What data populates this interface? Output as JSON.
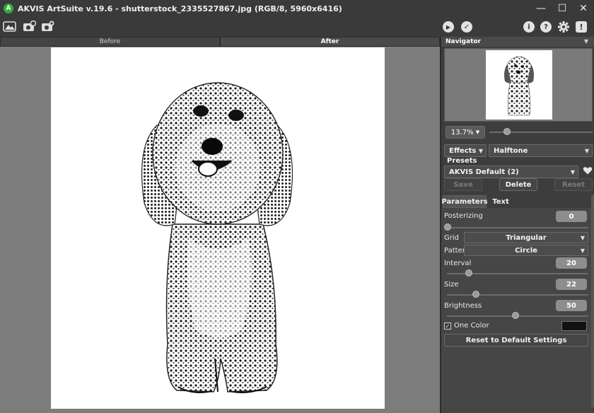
{
  "window": {
    "title": "AKVIS ArtSuite v.19.6 - shutterstock_2335527867.jpg (RGB/8, 5960x6416)",
    "logo_letter": "A",
    "minimize": "—",
    "maximize": "☐",
    "close": "✕"
  },
  "toolbar": {
    "open_icon": "image-open-icon",
    "save_icon": "save-image-icon",
    "batch_icon": "batch-icon",
    "run_label": "▶",
    "apply_label": "✓",
    "info_label": "i",
    "help_label": "?",
    "settings_icon": "gear-icon",
    "notify_label": "!"
  },
  "canvas": {
    "tabs": [
      "Before",
      "After"
    ],
    "active_tab": "After"
  },
  "navigator": {
    "title": "Navigator",
    "zoom": "13.7%",
    "zoom_slider_position": 0.18
  },
  "effects": {
    "category": "Effects",
    "effect": "Halftone"
  },
  "presets": {
    "label": "Presets",
    "selected": "AKVIS Default (2)",
    "save": "Save",
    "delete": "Delete",
    "reset": "Reset"
  },
  "param_tabs": [
    "Parameters",
    "Text"
  ],
  "params": {
    "posterizing": {
      "label": "Posterizing",
      "value": "0",
      "position": 0.0
    },
    "grid": {
      "label": "Grid",
      "value": "Triangular"
    },
    "pattern": {
      "label": "Pattern",
      "value": "Circle"
    },
    "interval": {
      "label": "Interval",
      "value": "20",
      "position": 0.17
    },
    "size": {
      "label": "Size",
      "value": "22",
      "position": 0.22
    },
    "brightness": {
      "label": "Brightness",
      "value": "50",
      "position": 0.5
    },
    "one_color": {
      "label": "One Color",
      "checked": true,
      "check_glyph": "✓",
      "color": "#121212"
    },
    "reset_button": "Reset to Default Settings"
  },
  "colors": {
    "panel": "#3d3d3d",
    "canvas_bg": "#7c7c7c",
    "logo": "#2fae3a"
  }
}
